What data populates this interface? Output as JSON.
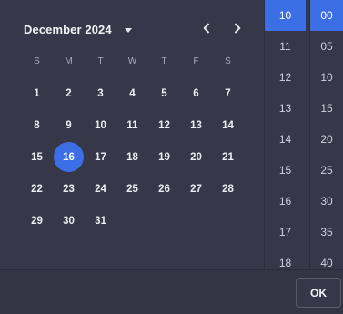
{
  "calendar": {
    "month_label": "December 2024",
    "weekdays": [
      "S",
      "M",
      "T",
      "W",
      "T",
      "F",
      "S"
    ],
    "weeks": [
      [
        "1",
        "2",
        "3",
        "4",
        "5",
        "6",
        "7"
      ],
      [
        "8",
        "9",
        "10",
        "11",
        "12",
        "13",
        "14"
      ],
      [
        "15",
        "16",
        "17",
        "18",
        "19",
        "20",
        "21"
      ],
      [
        "22",
        "23",
        "24",
        "25",
        "26",
        "27",
        "28"
      ],
      [
        "29",
        "30",
        "31",
        "",
        "",
        "",
        ""
      ]
    ],
    "selected_day": "16"
  },
  "time": {
    "hours": [
      "10",
      "11",
      "12",
      "13",
      "14",
      "15",
      "16",
      "17",
      "18"
    ],
    "selected_hour": "10",
    "minutes": [
      "00",
      "05",
      "10",
      "15",
      "20",
      "25",
      "30",
      "35",
      "40"
    ],
    "selected_minute": "00"
  },
  "footer": {
    "ok_label": "OK"
  },
  "colors": {
    "accent": "#3c6ee6",
    "background": "#363849"
  },
  "icons": {
    "month_dropdown": "caret-down-icon",
    "prev": "chevron-left-icon",
    "next": "chevron-right-icon"
  }
}
